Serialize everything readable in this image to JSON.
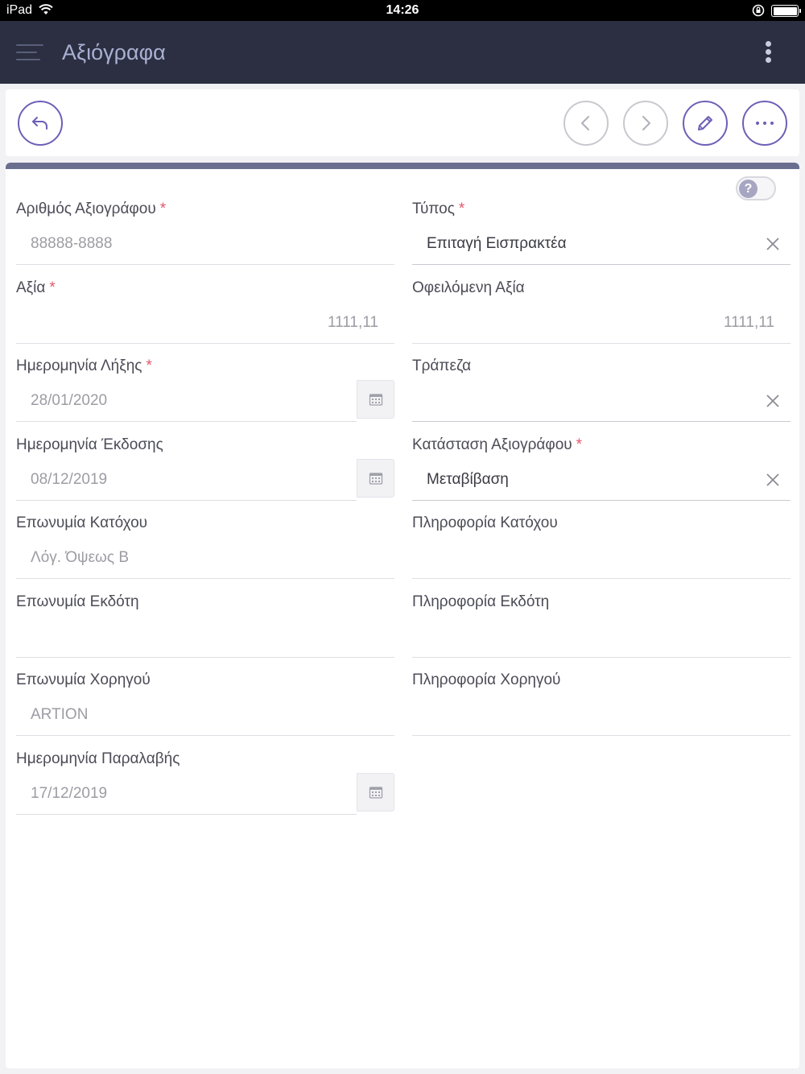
{
  "status_bar": {
    "device": "iPad",
    "time": "14:26"
  },
  "header": {
    "title": "Αξιόγραφα"
  },
  "form": {
    "fields": [
      {
        "label": "Αριθμός Αξιογράφου",
        "value": "88888-8888"
      },
      {
        "label": "Τύπος",
        "value": "Επιταγή Εισπρακτέα"
      },
      {
        "label": "Αξία",
        "value": "1111,11"
      },
      {
        "label": "Οφειλόμενη Αξία",
        "value": "1111,11"
      },
      {
        "label": "Ημερομηνία Λήξης",
        "value": "28/01/2020"
      },
      {
        "label": "Τράπεζα",
        "value": ""
      },
      {
        "label": "Ημερομηνία Έκδοσης",
        "value": "08/12/2019"
      },
      {
        "label": "Κατάσταση Αξιογράφου",
        "value": "Μεταβίβαση"
      },
      {
        "label": "Επωνυμία Κατόχου",
        "value": "Λόγ. Όψεως Β"
      },
      {
        "label": "Πληροφορία Κατόχου",
        "value": ""
      },
      {
        "label": "Επωνυμία Εκδότη",
        "value": ""
      },
      {
        "label": "Πληροφορία Εκδότη",
        "value": ""
      },
      {
        "label": "Επωνυμία Χορηγού",
        "value": "ARTION"
      },
      {
        "label": "Πληροφορία Χορηγού",
        "value": ""
      },
      {
        "label": "Ημερομηνία Παραλαβής",
        "value": "17/12/2019"
      }
    ],
    "required_mark": "*",
    "help_icon": "?"
  },
  "icons": {
    "back": "undo-arrow-icon",
    "prev": "chevron-left-icon",
    "next": "chevron-right-icon",
    "edit": "pencil-icon",
    "more": "more-horizontal-icon",
    "calendar": "calendar-icon",
    "clear": "close-icon"
  },
  "colors": {
    "accent": "#6e5fb6",
    "header_bg": "#2b2f41",
    "required": "#e4566b"
  }
}
